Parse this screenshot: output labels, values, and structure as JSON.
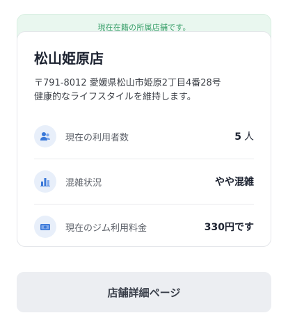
{
  "banner": {
    "text": "現在在籍の所属店舗です。"
  },
  "store": {
    "name": "松山姫原店",
    "address": "〒791-8012 愛媛県松山市姫原2丁目4番28号",
    "description": "健康的なライフスタイルを維持します。"
  },
  "stats": [
    {
      "icon": "users-icon",
      "label": "現在の利用者数",
      "value": "5",
      "unit": "人"
    },
    {
      "icon": "bar-chart-icon",
      "label": "混雑状況",
      "value": "やや混雑",
      "unit": ""
    },
    {
      "icon": "money-icon",
      "label": "現在のジム利用料金",
      "value": "330円です",
      "unit": ""
    }
  ],
  "colors": {
    "accent_green": "#3aa06b",
    "icon_blue": "#3a78d8",
    "icon_bg": "#e8effa"
  },
  "button": {
    "label": "店舗詳細ページ"
  }
}
